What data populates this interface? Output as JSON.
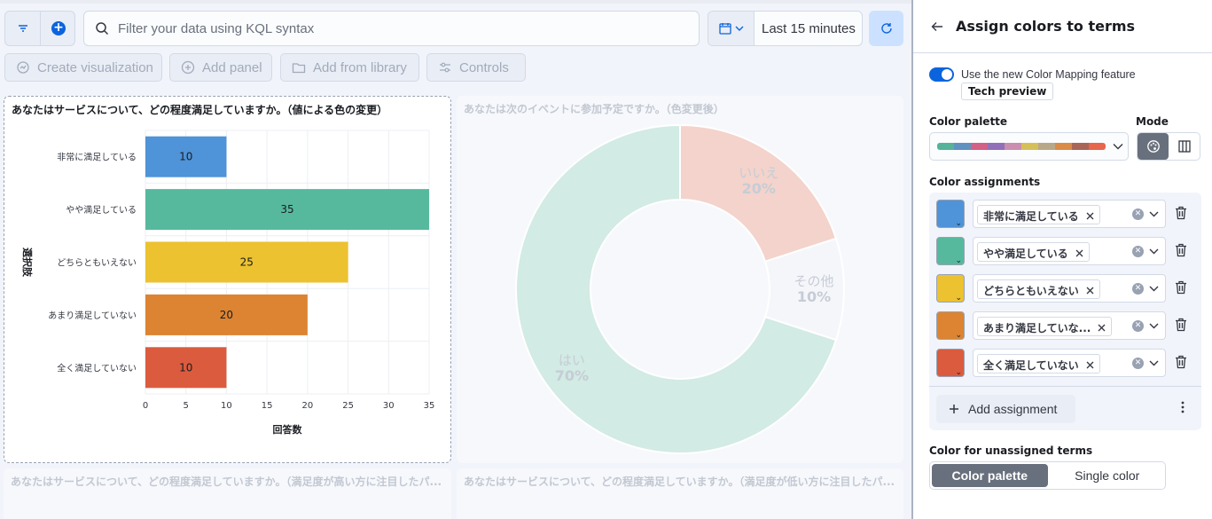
{
  "query_bar": {
    "search_placeholder": "Filter your data using KQL syntax",
    "time_range": "Last 15 minutes"
  },
  "toolbar": {
    "create_visualization": "Create visualization",
    "add_panel": "Add panel",
    "add_from_library": "Add from library",
    "controls": "Controls"
  },
  "panels": {
    "main_title": "あなたはサービスについて、どの程度満足していますか。（値による色の変更）",
    "donut_title": "あなたは次のイベントに参加予定ですか。（色変更後）",
    "bottom_left_title": "あなたはサービスについて、どの程度満足していますか。（満足度が高い方に注目したパ...",
    "bottom_right_title": "あなたはサービスについて、どの程度満足していますか。（満足度が低い方に注目したパ..."
  },
  "chart_data": [
    {
      "type": "bar",
      "orientation": "horizontal",
      "categories": [
        "非常に満足している",
        "やや満足している",
        "どちらともいえない",
        "あまり満足していない",
        "全く満足していない"
      ],
      "values": [
        10,
        35,
        25,
        20,
        10
      ],
      "colors": [
        "#4f93d8",
        "#56b99e",
        "#ecc230",
        "#dc8431",
        "#db5b3e"
      ],
      "xlabel": "回答数",
      "ylabel": "選択肢",
      "xlim": [
        0,
        35
      ],
      "xticks": [
        "0",
        "5",
        "10",
        "15",
        "20",
        "25",
        "30",
        "35"
      ],
      "grid": true
    },
    {
      "type": "pie",
      "donut": true,
      "labels": [
        "いいえ",
        "その他",
        "はい"
      ],
      "values": [
        20,
        10,
        70
      ],
      "display": [
        "20%",
        "10%",
        "70%"
      ],
      "colors": [
        "#f3d3cb",
        "#f5f6fa",
        "#d2ebe4"
      ]
    }
  ],
  "flyout": {
    "title": "Assign colors to terms",
    "toggle_label": "Use the new Color Mapping feature",
    "badge": "Tech preview",
    "palette_label": "Color palette",
    "mode_label": "Mode",
    "palette_colors": [
      "#54b399",
      "#6092c0",
      "#d36086",
      "#9170b8",
      "#ca8eae",
      "#d6bf57",
      "#b9a888",
      "#da8b45",
      "#aa6556",
      "#e7664c"
    ],
    "assignments_label": "Color assignments",
    "assignments": [
      {
        "term": "非常に満足している",
        "color": "#4f93d8"
      },
      {
        "term": "やや満足している",
        "color": "#56b99e"
      },
      {
        "term": "どちらともいえない",
        "color": "#ecc230"
      },
      {
        "term": "あまり満足していな...",
        "color": "#dc8431"
      },
      {
        "term": "全く満足していない",
        "color": "#db5b3e"
      }
    ],
    "add_assignment": "Add assignment",
    "unassigned_label": "Color for unassigned terms",
    "unassigned_options": [
      "Color palette",
      "Single color"
    ],
    "unassigned_selected": "Color palette"
  }
}
